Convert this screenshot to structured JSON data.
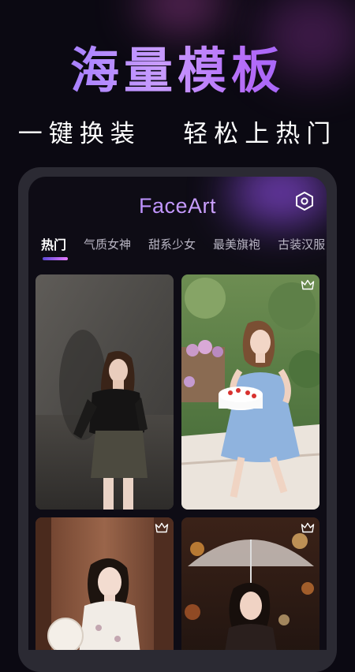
{
  "promo": {
    "headline": "海量模板",
    "subline": "一键换装   轻松上热门"
  },
  "app": {
    "title": "FaceArt",
    "settings_icon": "settings-hexagon-icon"
  },
  "tabs": [
    {
      "label": "热门",
      "active": true
    },
    {
      "label": "气质女神",
      "active": false
    },
    {
      "label": "甜系少女",
      "active": false
    },
    {
      "label": "最美旗袍",
      "active": false
    },
    {
      "label": "古装汉服",
      "active": false
    }
  ],
  "templates": [
    {
      "name": "template-photo-1",
      "premium": false
    },
    {
      "name": "template-photo-2",
      "premium": true
    },
    {
      "name": "template-photo-3",
      "premium": true
    },
    {
      "name": "template-photo-4",
      "premium": true
    }
  ],
  "colors": {
    "background": "#0b0912",
    "accent_purple": "#b46bf7",
    "tab_indicator_start": "#5d4ad6",
    "tab_indicator_end": "#e87aff"
  }
}
